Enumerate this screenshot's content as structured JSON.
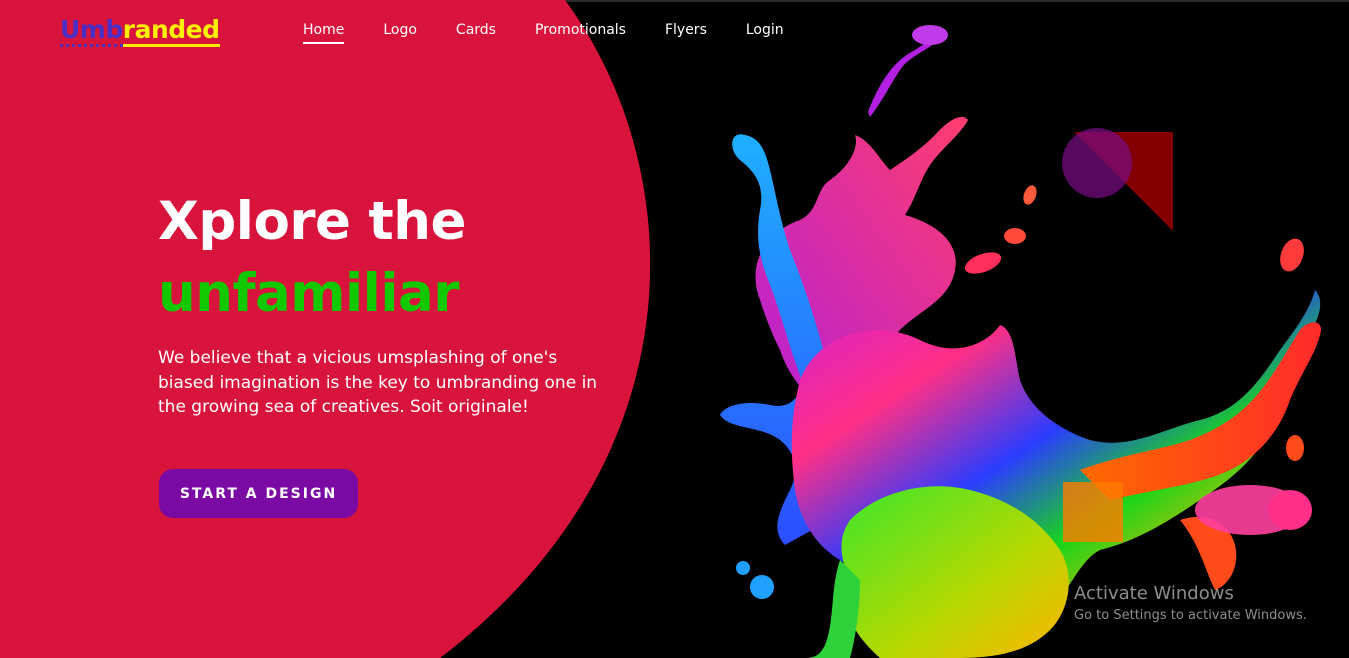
{
  "brand": {
    "logo_part1": "Umb",
    "logo_part2": "randed",
    "color_part1": "#4b2fc4",
    "color_part2": "#ffef00"
  },
  "nav": {
    "items": [
      {
        "label": "Home",
        "active": true
      },
      {
        "label": "Logo",
        "active": false
      },
      {
        "label": "Cards",
        "active": false
      },
      {
        "label": "Promotionals",
        "active": false
      },
      {
        "label": "Flyers",
        "active": false
      },
      {
        "label": "Login",
        "active": false
      }
    ]
  },
  "hero": {
    "title_line1": "Xplore the",
    "title_line2": "unfamiliar",
    "description": "We believe that a vicious umsplashing of one's biased imagination is the key to umbranding one in the growing sea of creatives. Soit originale!",
    "cta_label": "START A DESIGN",
    "accent_color": "#12c800",
    "background_color": "#d9143c",
    "cta_color": "#7a0aa3"
  },
  "illustration": {
    "name": "paint-splash-illustration"
  },
  "watermark": {
    "title": "Activate Windows",
    "subtitle": "Go to Settings to activate Windows."
  }
}
